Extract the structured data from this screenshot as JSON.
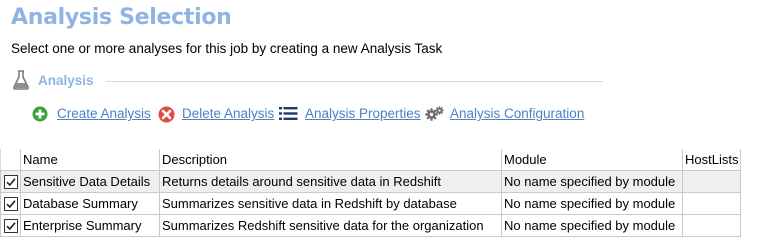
{
  "header": {
    "title": "Analysis Selection",
    "subtitle": "Select one or more analyses for this job by creating a new Analysis Task"
  },
  "section": {
    "label": "Analysis",
    "icon": "flask-icon"
  },
  "toolbar": {
    "items": [
      {
        "label": "Create Analysis",
        "icon": "plus-circle-icon",
        "color": "#3aa13a"
      },
      {
        "label": "Delete Analysis",
        "icon": "delete-x-circle-icon",
        "color": "#e04a3f"
      },
      {
        "label": "Analysis Properties",
        "icon": "list-icon",
        "color": "#1f3b6b"
      },
      {
        "label": "Analysis Configuration",
        "icon": "gears-icon",
        "color": "#6c6c6c"
      }
    ]
  },
  "table": {
    "columns": [
      "Name",
      "Description",
      "Module",
      "HostLists"
    ],
    "rows": [
      {
        "checked": true,
        "name": "Sensitive Data Details",
        "description": "Returns details around sensitive data in Redshift",
        "module": "No name specified by module",
        "hostlists": ""
      },
      {
        "checked": true,
        "name": "Database Summary",
        "description": "Summarizes sensitive data in Redshift by database",
        "module": "No name specified by module",
        "hostlists": ""
      },
      {
        "checked": true,
        "name": "Enterprise Summary",
        "description": "Summarizes Redshift sensitive data for the organization",
        "module": "No name specified by module",
        "hostlists": ""
      }
    ]
  },
  "colors": {
    "title": "#8fb4e3",
    "link": "#4f80c4",
    "selected_row": "#efefef"
  }
}
